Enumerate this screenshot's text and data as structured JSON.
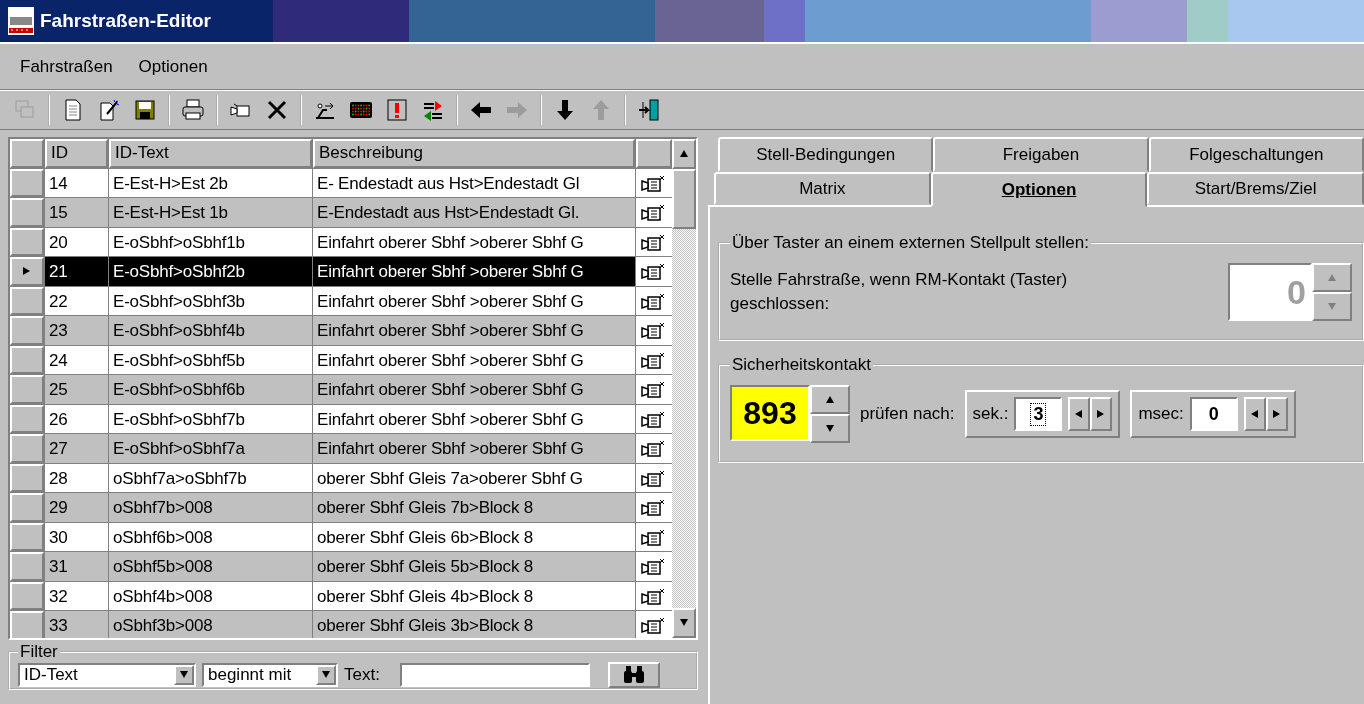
{
  "window": {
    "title": "Fahrstraßen-Editor"
  },
  "menu": [
    {
      "label": "Fahrstraßen"
    },
    {
      "label": "Optionen"
    }
  ],
  "toolbar": [
    [
      {
        "kind": "windows",
        "disabled": true
      }
    ],
    [
      {
        "kind": "new",
        "disabled": false
      },
      {
        "kind": "wand",
        "disabled": false
      },
      {
        "kind": "save",
        "disabled": false
      }
    ],
    [
      {
        "kind": "print",
        "disabled": false
      }
    ],
    [
      {
        "kind": "camera",
        "disabled": false
      },
      {
        "kind": "delete",
        "disabled": false
      }
    ],
    [
      {
        "kind": "route",
        "disabled": false
      },
      {
        "kind": "matrix",
        "disabled": false
      },
      {
        "kind": "alert",
        "disabled": false
      },
      {
        "kind": "swap",
        "disabled": false
      }
    ],
    [
      {
        "kind": "left",
        "disabled": false
      },
      {
        "kind": "right",
        "disabled": true
      }
    ],
    [
      {
        "kind": "down",
        "disabled": false
      },
      {
        "kind": "up",
        "disabled": true
      }
    ],
    [
      {
        "kind": "exit",
        "disabled": false
      }
    ]
  ],
  "grid": {
    "columns": [
      "ID",
      "ID-Text",
      "Beschreibung"
    ],
    "rows": [
      {
        "id": "14",
        "id_text": "E-Est-H>Est 2b",
        "description": "E- Endestadt aus Hst>Endestadt Gl",
        "selected": false
      },
      {
        "id": "15",
        "id_text": "E-Est-H>Est 1b",
        "description": "E-Endestadt aus Hst>Endestadt Gl.",
        "selected": false
      },
      {
        "id": "20",
        "id_text": "E-oSbhf>oSbhf1b",
        "description": "Einfahrt oberer Sbhf >oberer Sbhf G",
        "selected": false
      },
      {
        "id": "21",
        "id_text": "E-oSbhf>oSbhf2b",
        "description": "Einfahrt oberer Sbhf >oberer Sbhf G",
        "selected": true
      },
      {
        "id": "22",
        "id_text": "E-oSbhf>oSbhf3b",
        "description": "Einfahrt oberer Sbhf >oberer Sbhf G",
        "selected": false
      },
      {
        "id": "23",
        "id_text": "E-oSbhf>oSbhf4b",
        "description": "Einfahrt oberer Sbhf >oberer Sbhf G",
        "selected": false
      },
      {
        "id": "24",
        "id_text": "E-oSbhf>oSbhf5b",
        "description": "Einfahrt oberer Sbhf >oberer Sbhf G",
        "selected": false
      },
      {
        "id": "25",
        "id_text": "E-oSbhf>oSbhf6b",
        "description": "Einfahrt oberer Sbhf >oberer Sbhf G",
        "selected": false
      },
      {
        "id": "26",
        "id_text": "E-oSbhf>oSbhf7b",
        "description": "Einfahrt oberer Sbhf >oberer Sbhf G",
        "selected": false
      },
      {
        "id": "27",
        "id_text": "E-oSbhf>oSbhf7a",
        "description": "Einfahrt oberer Sbhf >oberer Sbhf G",
        "selected": false
      },
      {
        "id": "28",
        "id_text": "oSbhf7a>oSbhf7b",
        "description": "oberer Sbhf Gleis 7a>oberer Sbhf G",
        "selected": false
      },
      {
        "id": "29",
        "id_text": "oSbhf7b>008",
        "description": "oberer Sbhf Gleis 7b>Block 8",
        "selected": false
      },
      {
        "id": "30",
        "id_text": "oSbhf6b>008",
        "description": "oberer Sbhf Gleis 6b>Block 8",
        "selected": false
      },
      {
        "id": "31",
        "id_text": "oSbhf5b>008",
        "description": "oberer Sbhf Gleis 5b>Block 8",
        "selected": false
      },
      {
        "id": "32",
        "id_text": "oSbhf4b>008",
        "description": "oberer Sbhf Gleis 4b>Block 8",
        "selected": false
      },
      {
        "id": "33",
        "id_text": "oSbhf3b>008",
        "description": "oberer Sbhf Gleis 3b>Block 8",
        "selected": false
      }
    ]
  },
  "filter": {
    "title": "Filter",
    "field": "ID-Text",
    "mode": "beginnt mit",
    "text_label": "Text:"
  },
  "tabs": [
    [
      {
        "label": "Stell-Bedingungen",
        "selected": false
      },
      {
        "label": "Freigaben",
        "selected": false
      },
      {
        "label": "Folgeschaltungen",
        "selected": false
      }
    ],
    [
      {
        "label": "Matrix",
        "selected": false
      },
      {
        "label": "Optionen",
        "selected": true
      },
      {
        "label": "Start/Brems/Ziel",
        "selected": false
      }
    ]
  ],
  "options": {
    "external": {
      "title": "Über Taster an einem externen Stellpult stellen:",
      "label": "Stelle Fahrstraße, wenn RM-Kontakt (Taster) geschlossen:",
      "value": "0",
      "disabled": true
    },
    "safety": {
      "title": "Sicherheitskontakt",
      "value": "893",
      "check_label": "prüfen nach:",
      "sec_label": "sek.:",
      "sec_value": "3",
      "msec_label": "msec:",
      "msec_value": "0"
    }
  }
}
